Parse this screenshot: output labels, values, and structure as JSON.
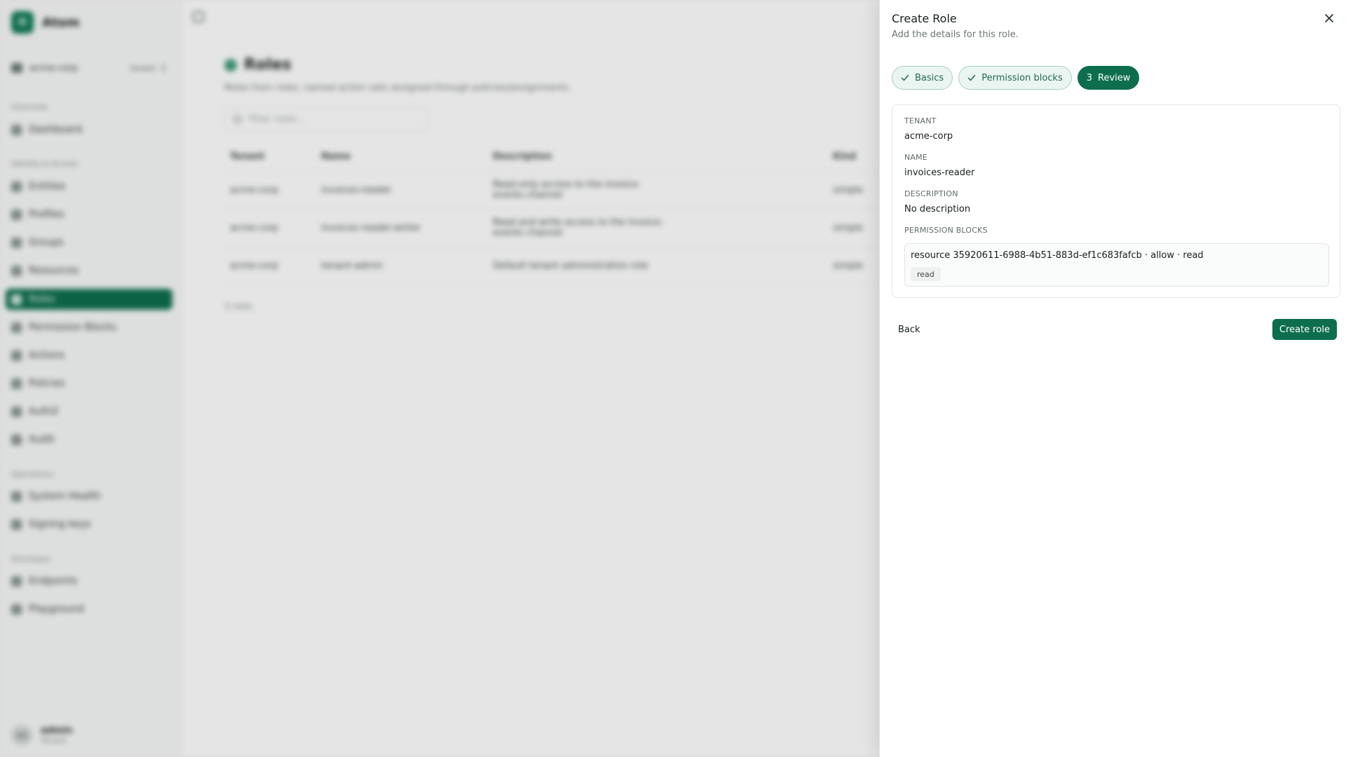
{
  "app": {
    "brand_initial": "O",
    "brand_name": "Atom",
    "tenant": "acme-corp",
    "tenant_badge": "tenant"
  },
  "sidebar": {
    "groups": [
      "Overview",
      "Identity & Access",
      "Operations",
      "Developer"
    ],
    "items": [
      {
        "label": "Dashboard"
      },
      {
        "label": "Entities"
      },
      {
        "label": "Profiles"
      },
      {
        "label": "Groups"
      },
      {
        "label": "Resources"
      },
      {
        "label": "Roles"
      },
      {
        "label": "Permission Blocks"
      },
      {
        "label": "Actions"
      },
      {
        "label": "Policies"
      },
      {
        "label": "AuthZ"
      },
      {
        "label": "Audit"
      },
      {
        "label": "System Health"
      },
      {
        "label": "Signing keys"
      },
      {
        "label": "Endpoints"
      },
      {
        "label": "Playground"
      }
    ],
    "user": {
      "initials": "AD",
      "name": "admin",
      "role": "Tenant"
    }
  },
  "main": {
    "title": "Roles",
    "subtitle": "Roles from roles; named action sets assigned through policies/assignments.",
    "filter_placeholder": "Filter roles...",
    "columns": [
      "Tenant",
      "Name",
      "Description",
      "Kind"
    ],
    "rows": [
      {
        "tenant": "acme-corp",
        "name": "invoices-reader",
        "description": "Read-only access to the invoice-events channel",
        "kind": "simple"
      },
      {
        "tenant": "acme-corp",
        "name": "invoices-reader-writer",
        "description": "Read and write access to the invoice-events channel",
        "kind": "simple"
      },
      {
        "tenant": "acme-corp",
        "name": "tenant-admin",
        "description": "Default tenant administration role",
        "kind": "simple"
      }
    ],
    "count": "3 roles"
  },
  "sheet": {
    "title": "Create Role",
    "subtitle": "Add the details for this role.",
    "steps": [
      {
        "label": "Basics",
        "state": "done"
      },
      {
        "label": "Permission blocks",
        "state": "done"
      },
      {
        "label": "Review",
        "number": "3",
        "state": "current"
      }
    ],
    "review": {
      "tenant_label": "TENANT",
      "tenant_value": "acme-corp",
      "name_label": "NAME",
      "name_value": "invoices-reader",
      "description_label": "DESCRIPTION",
      "description_value": "No description",
      "blocks_label": "PERMISSION BLOCKS",
      "block_line": "resource 35920611-6988-4b51-883d-ef1c683fafcb · allow · read",
      "block_tag": "read"
    },
    "back_label": "Back",
    "create_label": "Create role"
  },
  "colors": {
    "accent": "#0d6e4d",
    "step_done_bg": "#eaf4f0"
  }
}
